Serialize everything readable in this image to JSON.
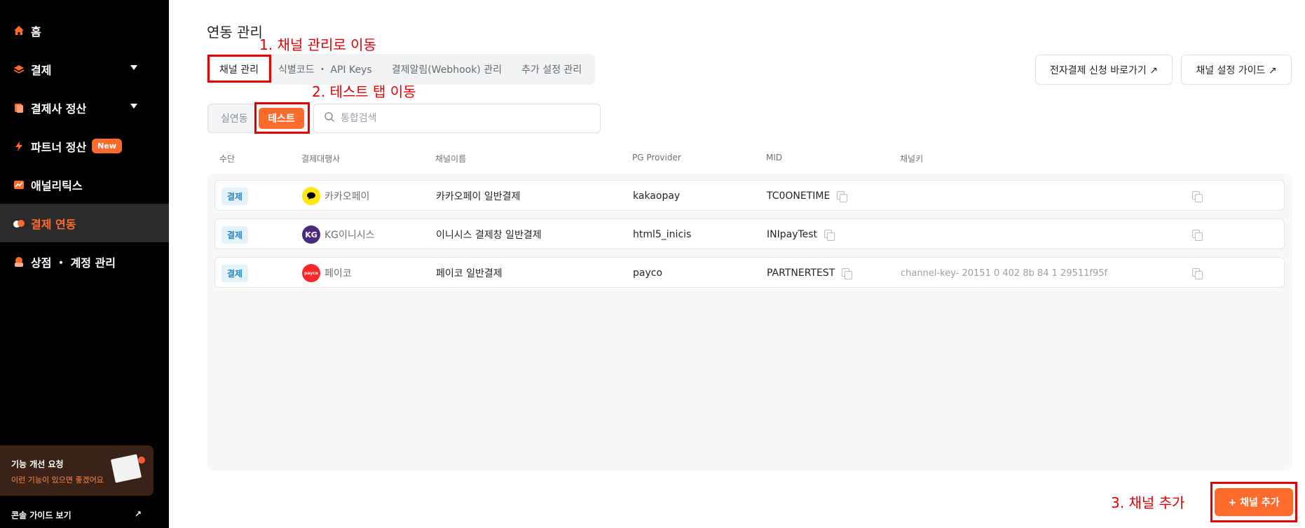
{
  "sidebar": {
    "items": [
      {
        "label": "홈"
      },
      {
        "label": "결제"
      },
      {
        "label": "결제사 정산"
      },
      {
        "label": "파트너 정산",
        "badge": "New"
      },
      {
        "label": "애널리틱스"
      },
      {
        "label": "결제 연동"
      },
      {
        "label": "상점 ・ 계정 관리"
      }
    ],
    "feedback": {
      "title": "기능 개선 요청",
      "subtitle": "이런 기능이 있으면 좋겠어요"
    },
    "guide_link": "콘솔 가이드 보기",
    "guide_arrow": "↗"
  },
  "header": {
    "title": "연동 관리",
    "tabs": [
      {
        "label": "채널 관리"
      },
      {
        "label": "식별코드 ・ API Keys"
      },
      {
        "label": "결제알림(Webhook) 관리"
      },
      {
        "label": "추가 설정 관리"
      }
    ],
    "buttons": {
      "apply": "전자결제 신청 바로가기 ↗",
      "guide": "채널 설정 가이드 ↗"
    }
  },
  "filter": {
    "modes": [
      "실연동",
      "테스트"
    ],
    "search_placeholder": "통합검색"
  },
  "table": {
    "columns": [
      "수단",
      "결제대행사",
      "채널이름",
      "PG Provider",
      "MID",
      "채널키"
    ],
    "rows": [
      {
        "method": "결제",
        "pg": "카카오페이",
        "logo_text": "",
        "logo_bg": "#ffe812",
        "logo_fg": "#000000",
        "channel": "카카오페이 일반결제",
        "provider": "kakaopay",
        "mid": "TC0ONETIME",
        "key": ""
      },
      {
        "method": "결제",
        "pg": "KG이니시스",
        "logo_text": "KG",
        "logo_bg": "#4a2a7a",
        "logo_fg": "#ffffff",
        "channel": "이니시스 결제창 일반결제",
        "provider": "html5_inicis",
        "mid": "INIpayTest",
        "key": ""
      },
      {
        "method": "결제",
        "pg": "페이코",
        "logo_text": "payco",
        "logo_bg": "#fa2828",
        "logo_fg": "#ffffff",
        "channel": "페이코 일반결제",
        "provider": "payco",
        "mid": "PARTNERTEST",
        "key": "channel-key-     20151 0   402 8b 84 1   29511f95f"
      }
    ]
  },
  "add_button": "+ 채널 추가",
  "annotations": {
    "step1": "1. 채널 관리로 이동",
    "step2": "2. 테스트 탭 이동",
    "step3": "3. 채널 추가"
  },
  "colors": {
    "accent": "#ff6b2c",
    "annotation": "#e00000"
  }
}
